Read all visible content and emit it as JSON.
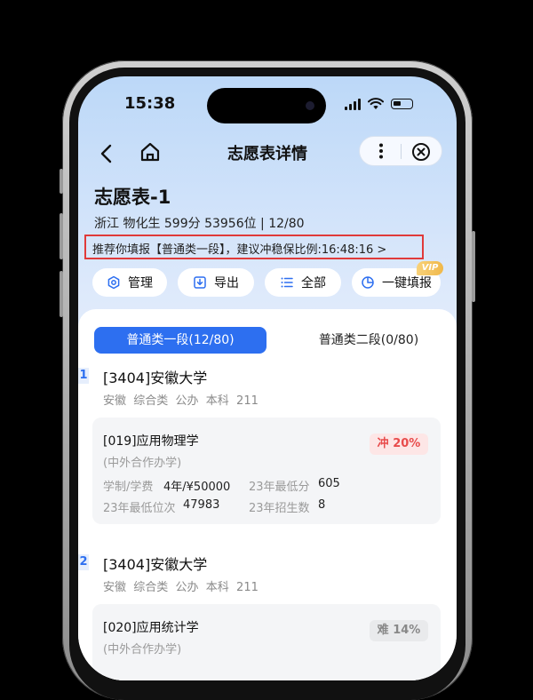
{
  "status_bar": {
    "time": "15:38"
  },
  "nav": {
    "title": "志愿表详情"
  },
  "plan": {
    "title": "志愿表-1",
    "info": "浙江 物化生 599分 53956位 | 12/80",
    "recommend": "推荐你填报【普通类一段】，建议冲稳保比例:16:48:16 >"
  },
  "actions": [
    {
      "label": "管理",
      "icon": "hexagon-settings-icon"
    },
    {
      "label": "导出",
      "icon": "download-icon"
    },
    {
      "label": "全部",
      "icon": "list-icon"
    },
    {
      "label": "一键填报",
      "icon": "pie-chart-icon",
      "badge": "VIP"
    }
  ],
  "tabs": [
    {
      "label": "普通类一段(12/80)",
      "active": true
    },
    {
      "label": "普通类二段(0/80)",
      "active": false
    }
  ],
  "entries": [
    {
      "index": "1",
      "university": "[3404]安徽大学",
      "meta": "安徽  综合类  公办  本科  211",
      "major": {
        "name": "[019]应用物理学",
        "sub": "(中外合作办学)",
        "badge": "冲 20%",
        "badge_type": "chong",
        "fields": [
          {
            "label": "学制/学费",
            "value": "4年/¥50000"
          },
          {
            "label": "23年最低分",
            "value": "605"
          },
          {
            "label": "23年最低位次",
            "value": "47983"
          },
          {
            "label": "23年招生数",
            "value": "8"
          }
        ]
      }
    },
    {
      "index": "2",
      "university": "[3404]安徽大学",
      "meta": "安徽  综合类  公办  本科  211",
      "major": {
        "name": "[020]应用统计学",
        "sub": "(中外合作办学)",
        "badge": "难 14%",
        "badge_type": "nan"
      }
    }
  ],
  "colors": {
    "accent": "#2d6ff0",
    "highlight_border": "#e03a3a",
    "chong": "#e84b4b"
  }
}
